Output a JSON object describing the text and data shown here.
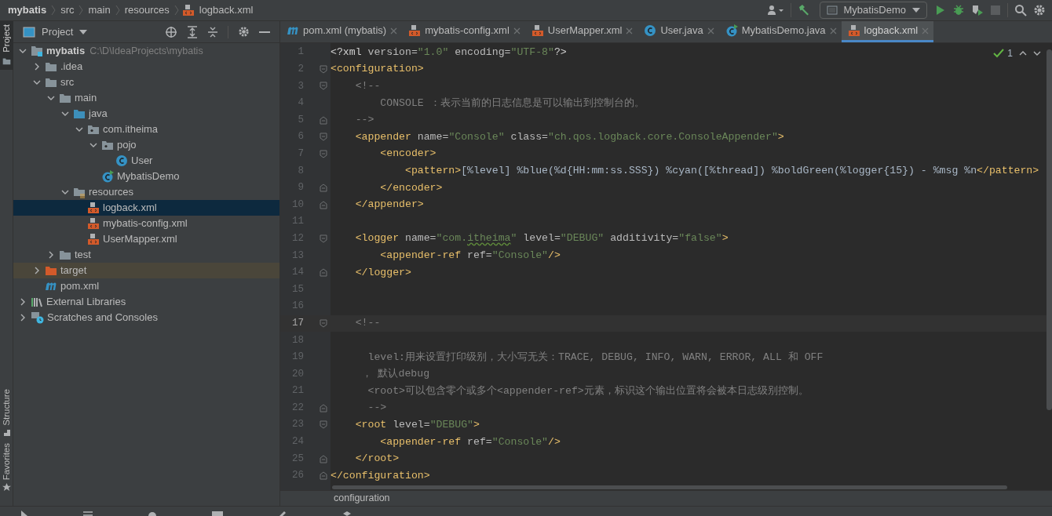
{
  "breadcrumbs": [
    {
      "label": "mybatis",
      "bold": true
    },
    {
      "label": "src",
      "bold": false
    },
    {
      "label": "main",
      "bold": false
    },
    {
      "label": "resources",
      "bold": false
    },
    {
      "label": "logback.xml",
      "bold": false,
      "kind": "xml"
    }
  ],
  "run_config": {
    "label": "MybatisDemo"
  },
  "side_tabs": [
    {
      "label": "Project",
      "selected": true,
      "kind": "folder"
    },
    {
      "label": "Structure",
      "selected": false,
      "kind": "structure"
    },
    {
      "label": "Favorites",
      "selected": false,
      "kind": "star"
    }
  ],
  "project_panel": {
    "title": "Project"
  },
  "tree": [
    {
      "label": "mybatis",
      "path": "C:\\D\\IdeaProjects\\mybatis",
      "kind": "module",
      "expanded": true,
      "selected": false,
      "excluded": false,
      "children": [
        {
          "label": ".idea",
          "kind": "folder",
          "expanded": false,
          "selected": false,
          "excluded": false
        },
        {
          "label": "src",
          "kind": "folder",
          "expanded": true,
          "selected": false,
          "excluded": false,
          "children": [
            {
              "label": "main",
              "kind": "folder",
              "expanded": true,
              "selected": false,
              "excluded": false,
              "children": [
                {
                  "label": "java",
                  "kind": "source",
                  "expanded": true,
                  "selected": false,
                  "excluded": false,
                  "children": [
                    {
                      "label": "com.itheima",
                      "kind": "package",
                      "expanded": true,
                      "selected": false,
                      "excluded": false,
                      "children": [
                        {
                          "label": "pojo",
                          "kind": "package",
                          "expanded": true,
                          "selected": false,
                          "excluded": false,
                          "children": [
                            {
                              "label": "User",
                              "kind": "class",
                              "selected": false,
                              "excluded": false
                            }
                          ]
                        },
                        {
                          "label": "MybatisDemo",
                          "kind": "main-class",
                          "selected": false,
                          "excluded": false
                        }
                      ]
                    }
                  ]
                },
                {
                  "label": "resources",
                  "kind": "resources",
                  "expanded": true,
                  "selected": false,
                  "excluded": false,
                  "children": [
                    {
                      "label": "logback.xml",
                      "kind": "xml",
                      "selected": true,
                      "excluded": false
                    },
                    {
                      "label": "mybatis-config.xml",
                      "kind": "xml",
                      "selected": false,
                      "excluded": false
                    },
                    {
                      "label": "UserMapper.xml",
                      "kind": "xml",
                      "selected": false,
                      "excluded": false
                    }
                  ]
                }
              ]
            },
            {
              "label": "test",
              "kind": "folder",
              "expanded": false,
              "selected": false,
              "excluded": false
            }
          ]
        },
        {
          "label": "target",
          "kind": "excluded",
          "expanded": false,
          "selected": false,
          "excluded": true
        },
        {
          "label": "pom.xml",
          "kind": "maven",
          "selected": false,
          "excluded": false
        }
      ]
    },
    {
      "label": "External Libraries",
      "kind": "libraries",
      "expanded": false,
      "selected": false,
      "excluded": false
    },
    {
      "label": "Scratches and Consoles",
      "kind": "scratches",
      "expanded": false,
      "selected": false,
      "excluded": false
    }
  ],
  "tabs": [
    {
      "label": "pom.xml (mybatis)",
      "kind": "maven",
      "selected": false
    },
    {
      "label": "mybatis-config.xml",
      "kind": "xml",
      "selected": false
    },
    {
      "label": "UserMapper.xml",
      "kind": "xml",
      "selected": false
    },
    {
      "label": "User.java",
      "kind": "class",
      "selected": false
    },
    {
      "label": "MybatisDemo.java",
      "kind": "main-class",
      "selected": false
    },
    {
      "label": "logback.xml",
      "kind": "xml",
      "selected": true
    }
  ],
  "inspection": {
    "count": "1"
  },
  "lines": [
    {
      "number": "1",
      "current": false,
      "fold_start": false,
      "fold_end": false,
      "tokens": [
        {
          "kind": "punct",
          "text": "<?xml "
        },
        {
          "kind": "attr",
          "text": "version="
        },
        {
          "kind": "value",
          "text": "\"1.0\""
        },
        {
          "kind": "attr",
          "text": " encoding="
        },
        {
          "kind": "value",
          "text": "\"UTF-8\""
        },
        {
          "kind": "punct",
          "text": "?>"
        }
      ]
    },
    {
      "number": "2",
      "current": false,
      "fold_start": true,
      "fold_end": false,
      "tokens": [
        {
          "kind": "tag",
          "text": "<configuration>"
        }
      ]
    },
    {
      "number": "3",
      "current": false,
      "fold_start": true,
      "fold_end": false,
      "tokens": [
        {
          "kind": "comment",
          "text": "    <!--"
        }
      ]
    },
    {
      "number": "4",
      "current": false,
      "fold_start": false,
      "fold_end": false,
      "tokens": [
        {
          "kind": "comment",
          "text": "        CONSOLE ：表示当前的日志信息是可以输出到控制台的。"
        }
      ]
    },
    {
      "number": "5",
      "current": false,
      "fold_start": false,
      "fold_end": true,
      "tokens": [
        {
          "kind": "comment",
          "text": "    -->"
        }
      ]
    },
    {
      "number": "6",
      "current": false,
      "fold_start": true,
      "fold_end": false,
      "tokens": [
        {
          "kind": "tag",
          "text": "    <appender "
        },
        {
          "kind": "attr",
          "text": "name="
        },
        {
          "kind": "value",
          "text": "\"Console\""
        },
        {
          "kind": "attr",
          "text": " class="
        },
        {
          "kind": "value",
          "text": "\"ch.qos.logback.core.ConsoleAppender\""
        },
        {
          "kind": "tag",
          "text": ">"
        }
      ]
    },
    {
      "number": "7",
      "current": false,
      "fold_start": true,
      "fold_end": false,
      "tokens": [
        {
          "kind": "tag",
          "text": "        <encoder>"
        }
      ]
    },
    {
      "number": "8",
      "current": false,
      "fold_start": false,
      "fold_end": false,
      "tokens": [
        {
          "kind": "tag",
          "text": "            <pattern>"
        },
        {
          "kind": "text",
          "text": "[%level] %blue(%d{HH:mm:ss.SSS}) %cyan([%thread]) %boldGreen(%logger{15}) - %msg %n"
        },
        {
          "kind": "tag",
          "text": "</pattern>"
        }
      ]
    },
    {
      "number": "9",
      "current": false,
      "fold_start": false,
      "fold_end": true,
      "tokens": [
        {
          "kind": "tag",
          "text": "        </encoder>"
        }
      ]
    },
    {
      "number": "10",
      "current": false,
      "fold_start": false,
      "fold_end": true,
      "tokens": [
        {
          "kind": "tag",
          "text": "    </appender>"
        }
      ]
    },
    {
      "number": "11",
      "current": false,
      "fold_start": false,
      "fold_end": false
    },
    {
      "number": "12",
      "current": false,
      "fold_start": true,
      "fold_end": false,
      "tokens": [
        {
          "kind": "tag",
          "text": "    <logger "
        },
        {
          "kind": "attr",
          "text": "name="
        },
        {
          "kind": "value",
          "text": "\"com."
        },
        {
          "kind": "typo",
          "text": "itheima"
        },
        {
          "kind": "value",
          "text": "\""
        },
        {
          "kind": "attr",
          "text": " level="
        },
        {
          "kind": "value",
          "text": "\"DEBUG\""
        },
        {
          "kind": "attr",
          "text": " additivity="
        },
        {
          "kind": "value",
          "text": "\"false\""
        },
        {
          "kind": "tag",
          "text": ">"
        }
      ]
    },
    {
      "number": "13",
      "current": false,
      "fold_start": false,
      "fold_end": false,
      "tokens": [
        {
          "kind": "tag",
          "text": "        <appender-ref "
        },
        {
          "kind": "attr",
          "text": "ref="
        },
        {
          "kind": "value",
          "text": "\"Console\""
        },
        {
          "kind": "tag",
          "text": "/>"
        }
      ]
    },
    {
      "number": "14",
      "current": false,
      "fold_start": false,
      "fold_end": true,
      "tokens": [
        {
          "kind": "tag",
          "text": "    </logger>"
        }
      ]
    },
    {
      "number": "15",
      "current": false,
      "fold_start": false,
      "fold_end": false
    },
    {
      "number": "16",
      "current": false,
      "fold_start": false,
      "fold_end": false
    },
    {
      "number": "17",
      "current": true,
      "fold_start": true,
      "fold_end": false,
      "tokens": [
        {
          "kind": "comment",
          "text": "    <!--"
        }
      ]
    },
    {
      "number": "18",
      "current": false,
      "fold_start": false,
      "fold_end": false
    },
    {
      "number": "19",
      "current": false,
      "fold_start": false,
      "fold_end": false,
      "tokens": [
        {
          "kind": "comment",
          "text": "      level:用来设置打印级别，大小写无关：TRACE, DEBUG, INFO, WARN, ERROR, ALL 和 OFF"
        }
      ]
    },
    {
      "number": "20",
      "current": false,
      "fold_start": false,
      "fold_end": false,
      "tokens": [
        {
          "kind": "comment",
          "text": "     ， 默认debug"
        }
      ]
    },
    {
      "number": "21",
      "current": false,
      "fold_start": false,
      "fold_end": false,
      "tokens": [
        {
          "kind": "comment",
          "text": "      <root>可以包含零个或多个<appender-ref>元素，标识这个输出位置将会被本日志级别控制。"
        }
      ]
    },
    {
      "number": "22",
      "current": false,
      "fold_start": false,
      "fold_end": true,
      "tokens": [
        {
          "kind": "comment",
          "text": "      -->"
        }
      ]
    },
    {
      "number": "23",
      "current": false,
      "fold_start": true,
      "fold_end": false,
      "tokens": [
        {
          "kind": "tag",
          "text": "    <root "
        },
        {
          "kind": "attr",
          "text": "level="
        },
        {
          "kind": "value",
          "text": "\"DEBUG\""
        },
        {
          "kind": "tag",
          "text": ">"
        }
      ]
    },
    {
      "number": "24",
      "current": false,
      "fold_start": false,
      "fold_end": false,
      "tokens": [
        {
          "kind": "tag",
          "text": "        <appender-ref "
        },
        {
          "kind": "attr",
          "text": "ref="
        },
        {
          "kind": "value",
          "text": "\"Console\""
        },
        {
          "kind": "tag",
          "text": "/>"
        }
      ]
    },
    {
      "number": "25",
      "current": false,
      "fold_start": false,
      "fold_end": true,
      "tokens": [
        {
          "kind": "tag",
          "text": "    </root>"
        }
      ]
    },
    {
      "number": "26",
      "current": false,
      "fold_start": false,
      "fold_end": true,
      "tokens": [
        {
          "kind": "tag",
          "text": "</configuration>"
        }
      ]
    }
  ],
  "editor_breadcrumb": {
    "label": "configuration"
  }
}
